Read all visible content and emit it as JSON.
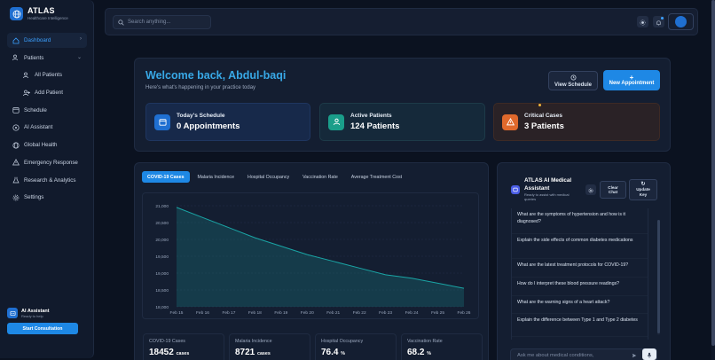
{
  "brand": {
    "title": "ATLAS",
    "subtitle": "Healthcare Intelligence"
  },
  "sidebar": {
    "items": [
      {
        "label": "Dashboard",
        "icon": "home-icon"
      },
      {
        "label": "Patients",
        "icon": "users-icon"
      },
      {
        "label": "All Patients",
        "icon": "users-icon"
      },
      {
        "label": "Add Patient",
        "icon": "user-plus-icon"
      },
      {
        "label": "Schedule",
        "icon": "calendar-icon"
      },
      {
        "label": "AI Assistant",
        "icon": "bot-icon"
      },
      {
        "label": "Global Health",
        "icon": "globe-icon"
      },
      {
        "label": "Emergency Response",
        "icon": "alert-icon"
      },
      {
        "label": "Research & Analytics",
        "icon": "flask-icon"
      },
      {
        "label": "Settings",
        "icon": "gear-icon"
      }
    ],
    "assistant_card": {
      "title": "AI Assistant",
      "subtitle": "Ready to help",
      "button": "Start Consultation"
    }
  },
  "topbar": {
    "search_placeholder": "Search anything..."
  },
  "welcome": {
    "title": "Welcome back, Abdul-baqi",
    "subtitle": "Here's what's happening in your practice today",
    "view_schedule": "View Schedule",
    "new_appointment": "New Appointment"
  },
  "stats": [
    {
      "label": "Today's Schedule",
      "value": "0 Appointments",
      "color": "#1f6fd1"
    },
    {
      "label": "Active Patients",
      "value": "124 Patients",
      "color": "#1a9e8a"
    },
    {
      "label": "Critical Cases",
      "value": "3 Patients",
      "color": "#e0692c"
    }
  ],
  "chart_tabs": [
    "COVID-19 Cases",
    "Malaria Incidence",
    "Hospital Occupancy",
    "Vaccination Rate",
    "Average Treatment Cost"
  ],
  "chart_data": {
    "type": "area",
    "x": [
      "Feb 15",
      "Feb 16",
      "Feb 17",
      "Feb 18",
      "Feb 19",
      "Feb 20",
      "Feb 21",
      "Feb 22",
      "Feb 23",
      "Feb 24",
      "Feb 25",
      "Feb 26"
    ],
    "values": [
      20950,
      20650,
      20350,
      20050,
      19800,
      19550,
      19350,
      19150,
      18950,
      18850,
      18700,
      18550
    ],
    "yticks": [
      "21,000",
      "20,500",
      "20,000",
      "19,500",
      "19,000",
      "18,500",
      "18,000"
    ],
    "ylim": [
      18000,
      21000
    ],
    "grid": true,
    "color": "#1aa5a5"
  },
  "metrics": [
    {
      "label": "COVID-19 Cases",
      "value": "18452",
      "unit": "cases"
    },
    {
      "label": "Malaria Incidence",
      "value": "8721",
      "unit": "cases"
    },
    {
      "label": "Hospital Occupancy",
      "value": "76.4",
      "unit": "%"
    },
    {
      "label": "Vaccination Rate",
      "value": "68.2",
      "unit": "%"
    }
  ],
  "ai": {
    "title": "ATLAS AI Medical Assistant",
    "subtitle": "Ready to assist with medical queries",
    "clear_chat": "Clear Chat",
    "update_key": "Update Key",
    "questions": [
      "What are the symptoms of hypertension and how is it diagnosed?",
      "Explain the side effects of common diabetes medications",
      "What are the latest treatment protocols for COVID-19?",
      "How do I interpret these blood pressure readings?",
      "What are the warning signs of a heart attack?",
      "Explain the difference between Type 1 and Type 2 diabetes"
    ],
    "input_placeholder": "Ask me about medical conditions,"
  }
}
